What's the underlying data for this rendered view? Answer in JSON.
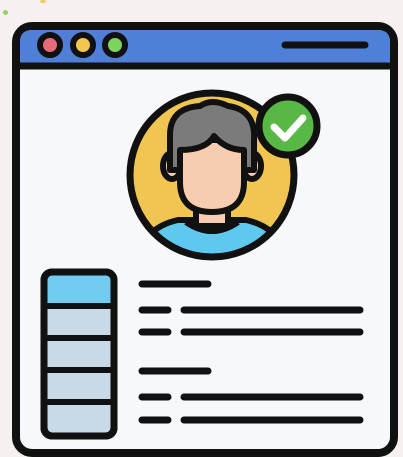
{
  "illustration": {
    "subject": "profile-verified-icon",
    "colors": {
      "background": "#f6f1ee",
      "window_body": "#f7f8fb",
      "title_bar": "#4f7fd6",
      "outline": "#111111",
      "dot_red": "#e86b7a",
      "dot_yellow": "#f2c84b",
      "dot_green": "#7dd45c",
      "avatar_circle": "#f0c552",
      "hair": "#7b7b7b",
      "skin": "#f7ccb0",
      "shirt": "#5fc8ee",
      "check_badge": "#58b846",
      "check_mark": "#ffffff",
      "sidebar_top_cell": "#72ccf2",
      "sidebar_cell": "#c8d9e8"
    },
    "icons": [
      "window-icon",
      "avatar-icon",
      "check-badge-icon",
      "sidebar-list-icon"
    ]
  }
}
